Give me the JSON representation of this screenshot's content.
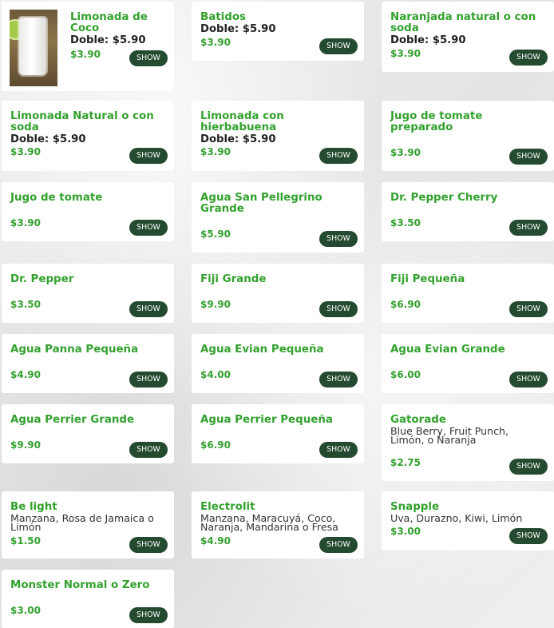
{
  "show_label": "SHOW",
  "items": [
    {
      "title": "Limonada de Coco",
      "doble": "Doble: $5.90",
      "desc": "",
      "price": "$3.90"
    },
    {
      "title": "Batidos",
      "doble": "Doble: $5.90",
      "desc": "",
      "price": "$3.90"
    },
    {
      "title": "Naranjada natural o con soda",
      "doble": "Doble: $5.90",
      "desc": "",
      "price": "$3.90"
    },
    {
      "title": "Limonada Natural o con soda",
      "doble": "Doble: $5.90",
      "desc": "",
      "price": "$3.90"
    },
    {
      "title": "Limonada con hierbabuena",
      "doble": "Doble: $5.90",
      "desc": "",
      "price": "$3.90"
    },
    {
      "title": "Jugo de tomate preparado",
      "doble": "",
      "desc": "",
      "price": "$3.90"
    },
    {
      "title": "Jugo de tomate",
      "doble": "",
      "desc": "",
      "price": "$3.90"
    },
    {
      "title": "Agua San Pellegrino Grande",
      "doble": "",
      "desc": "",
      "price": "$5.90"
    },
    {
      "title": "Dr. Pepper Cherry",
      "doble": "",
      "desc": "",
      "price": "$3.50"
    },
    {
      "title": "Dr. Pepper",
      "doble": "",
      "desc": "",
      "price": "$3.50"
    },
    {
      "title": "Fiji Grande",
      "doble": "",
      "desc": "",
      "price": "$9.90"
    },
    {
      "title": "Fiji Pequeña",
      "doble": "",
      "desc": "",
      "price": "$6.90"
    },
    {
      "title": "Agua Panna Pequeña",
      "doble": "",
      "desc": "",
      "price": "$4.90"
    },
    {
      "title": "Agua Evian Pequeña",
      "doble": "",
      "desc": "",
      "price": "$4.00"
    },
    {
      "title": "Agua Evian Grande",
      "doble": "",
      "desc": "",
      "price": "$6.00"
    },
    {
      "title": "Agua Perrier Grande",
      "doble": "",
      "desc": "",
      "price": "$9.90"
    },
    {
      "title": "Agua Perrier Pequeña",
      "doble": "",
      "desc": "",
      "price": "$6.90"
    },
    {
      "title": "Gatorade",
      "doble": "",
      "desc": "Blue Berry, Fruit Punch, Limón, o Naranja",
      "price": "$2.75"
    },
    {
      "title": "Be light",
      "doble": "",
      "desc": "Manzana, Rosa de Jamaica o Limón",
      "price": "$1.50"
    },
    {
      "title": "Electrolit",
      "doble": "",
      "desc": "Manzana, Maracuyá, Coco, Naranja, Mandarina o Fresa",
      "price": "$4.90"
    },
    {
      "title": "Snapple",
      "doble": "",
      "desc": "Uva, Durazno, Kiwi, Limón",
      "price": "$3.00"
    },
    {
      "title": "Monster Normal o Zero",
      "doble": "",
      "desc": "",
      "price": "$3.00"
    }
  ]
}
